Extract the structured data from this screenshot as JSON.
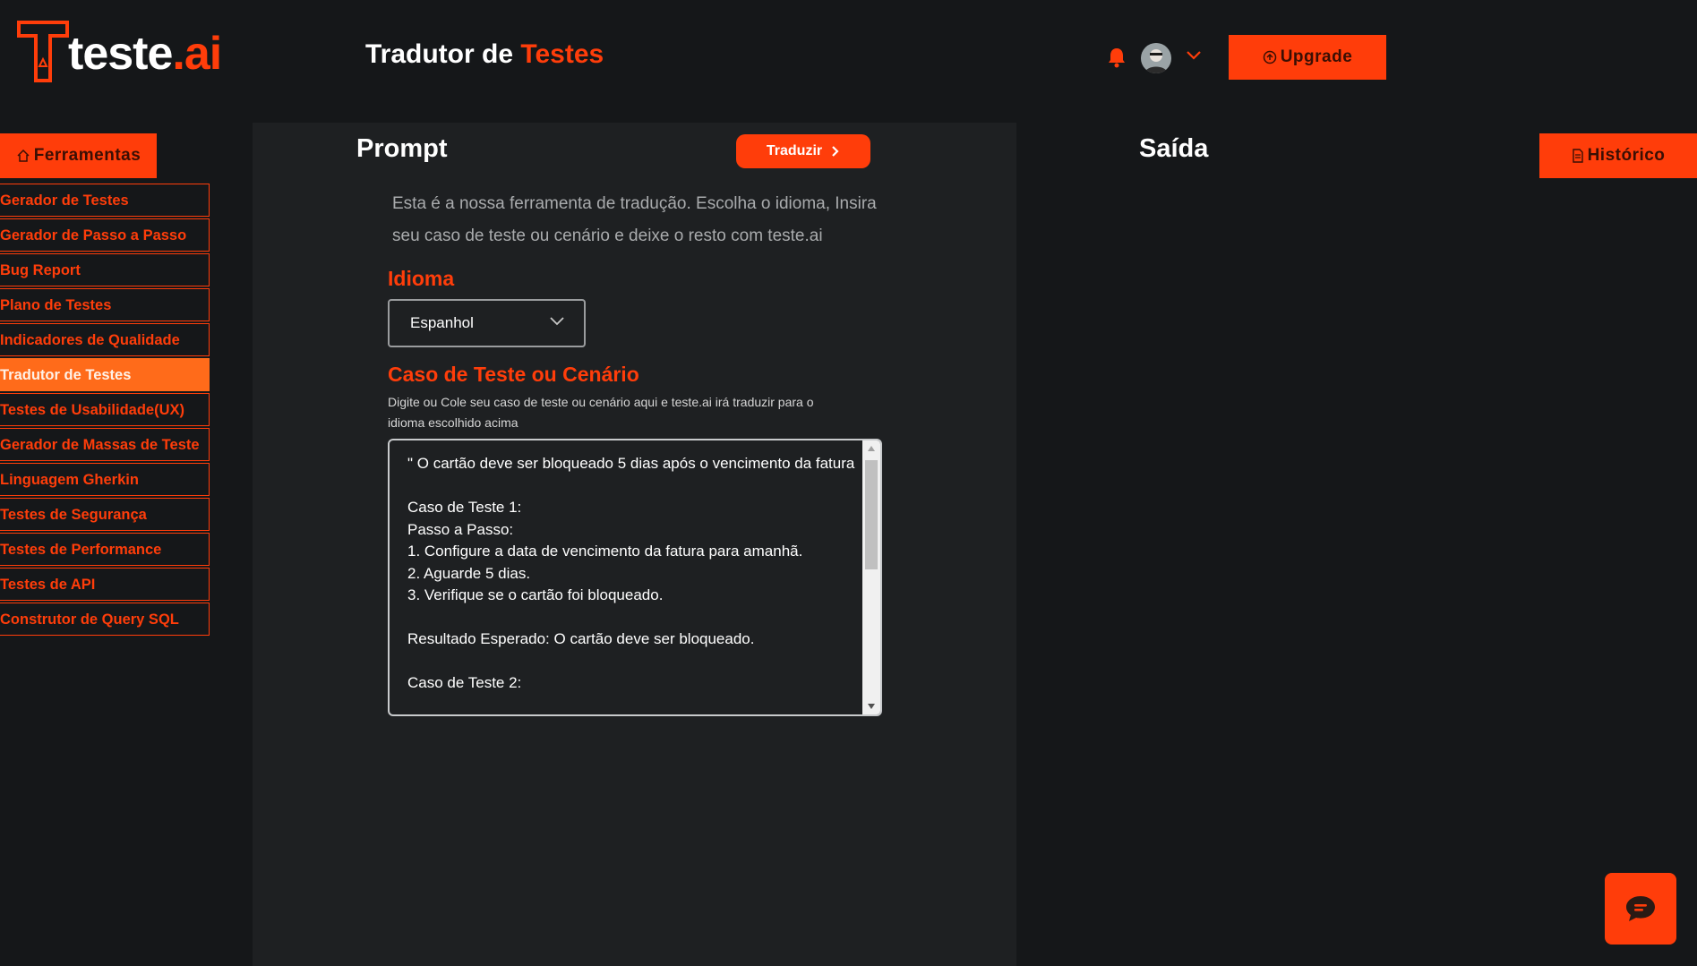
{
  "brand": {
    "name_part1": "teste",
    "name_part2": ".ai"
  },
  "header": {
    "title_part1": "Tradutor de ",
    "title_part2": "Testes",
    "upgrade_label": "Upgrade"
  },
  "sidebar": {
    "tools_label": "Ferramentas",
    "active_index": 5,
    "items": [
      {
        "label": "Gerador de Testes"
      },
      {
        "label": "Gerador de Passo a Passo"
      },
      {
        "label": "Bug Report"
      },
      {
        "label": "Plano de Testes"
      },
      {
        "label": "Indicadores de Qualidade"
      },
      {
        "label": "Tradutor de Testes"
      },
      {
        "label": "Testes de Usabilidade(UX)"
      },
      {
        "label": "Gerador de Massas de Teste"
      },
      {
        "label": "Linguagem Gherkin"
      },
      {
        "label": "Testes de Segurança"
      },
      {
        "label": "Testes de Performance"
      },
      {
        "label": "Testes de API"
      },
      {
        "label": "Construtor de Query SQL"
      }
    ]
  },
  "prompt": {
    "heading": "Prompt",
    "translate_label": "Traduzir",
    "description": "Esta é a nossa ferramenta de tradução. Escolha o idioma, Insira seu caso de teste ou cenário e deixe o resto com teste.ai",
    "language_label": "Idioma",
    "language_value": "Espanhol",
    "case_label": "Caso de Teste ou Cenário",
    "case_hint": "Digite ou Cole seu caso de teste ou cenário aqui e teste.ai irá traduzir para o idioma escolhido acima",
    "case_text": "\" O cartão deve ser bloqueado 5 dias após o vencimento da fatura\n\nCaso de Teste 1:\nPasso a Passo:\n1. Configure a data de vencimento da fatura para amanhã.\n2. Aguarde 5 dias.\n3. Verifique se o cartão foi bloqueado.\n\nResultado Esperado: O cartão deve ser bloqueado.\n\nCaso de Teste 2:"
  },
  "output": {
    "heading": "Saída",
    "history_label": "Histórico"
  },
  "colors": {
    "accent": "#ff3d0a",
    "active_item": "#ff6b1a",
    "background": "#151719",
    "panel": "#1e2022"
  },
  "icons": [
    "bell-icon",
    "user-avatar",
    "chevron-down-icon",
    "upgrade-icon",
    "home-icon",
    "chevron-right-icon",
    "document-icon",
    "chat-icon"
  ]
}
